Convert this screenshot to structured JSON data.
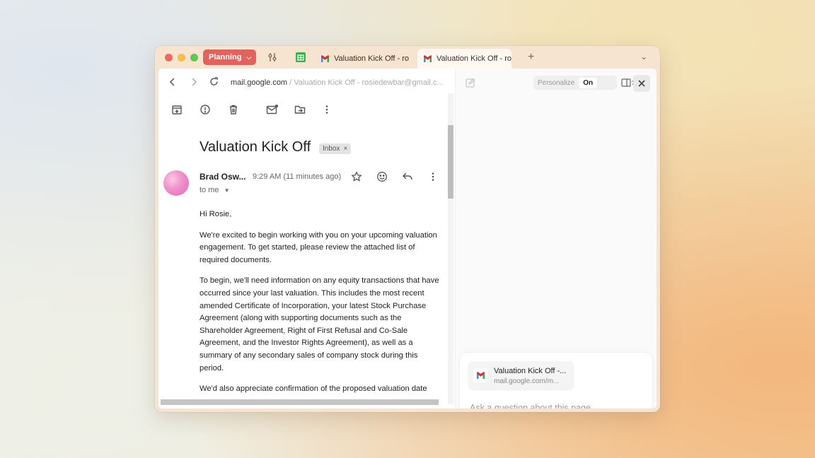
{
  "browser": {
    "space_label": "Planning",
    "tabs": [
      {
        "label": "Valuation Kick Off - rosiedewbar@gmail.com"
      },
      {
        "label": "Valuation Kick Off - rosiedewbar@gmail.com"
      }
    ],
    "new_tab_symbol": "+",
    "url_domain": "mail.google.com",
    "url_path": " / Valuation Kick Off - rosiedewbar@gmail.c..."
  },
  "email": {
    "subject": "Valuation Kick Off",
    "label_badge": "Inbox",
    "sender": "Brad Osw...",
    "time": "9:29 AM (11 minutes ago)",
    "recipient": "to me",
    "paragraphs": [
      "Hi Rosie,",
      "We're excited to begin working with you on your upcoming valuation engagement. To get started, please review the attached list of required documents.",
      "To begin, we'll need information on any equity transactions that have occurred since your last valuation. This includes the most recent amended Certificate of Incorporation, your latest Stock Purchase Agreement (along with supporting documents such as the Shareholder Agreement, Right of First Refusal and Co-Sale Agreement, and the Investor Rights Agreement), as well as a summary of any secondary sales of company stock during this period.",
      "We'd also appreciate confirmation of the proposed valuation date"
    ]
  },
  "assistant": {
    "personalize_label": "Personalize",
    "personalize_state": "On",
    "context_card": {
      "title": "Valuation Kick Off -...",
      "subtitle": "mail.google.com/m..."
    },
    "input_placeholder": "Ask a question about this page...",
    "send_color": "#c0373f"
  },
  "colors": {
    "space_pill": "#e0635d",
    "send_button": "#c0373f"
  },
  "icons": [
    "archive-icon",
    "report-spam-icon",
    "delete-icon",
    "mark-unread-icon",
    "move-to-icon",
    "more-vert-icon",
    "star-icon",
    "emoji-icon",
    "reply-icon"
  ]
}
